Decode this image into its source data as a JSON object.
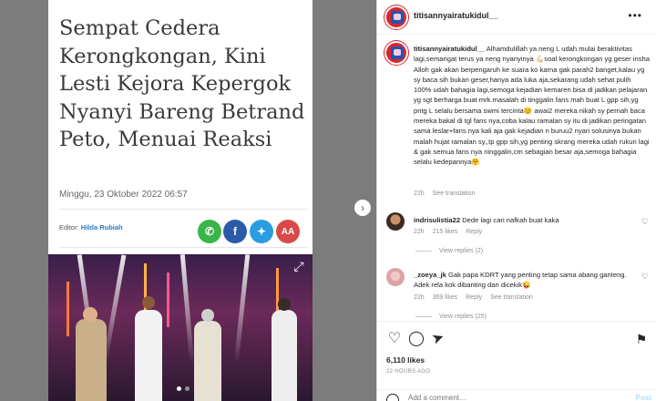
{
  "article": {
    "title": "Sempat Cedera Kerongkongan, Kini Lesti Kejora Kepergok Nyanyi Bareng Betrand Peto, Menuai Reaksi",
    "date": "Minggu, 23 Oktober 2022 06:57",
    "editor_label": "Editor:",
    "editor_name": "Hilda Rubiah",
    "share_aa": "AA"
  },
  "post": {
    "username": "titisannyairatukidul__",
    "more": "•••",
    "caption_user": "titisannyairatukidul__",
    "caption_text": "Alhamdulillah ya neng L udah mulai beraktivitas lagi,semangat terus ya neng nyanyinya 💪🏻soal kerongkongan yg geser insha Alloh gak akan berpengaruh ke suara ko karna gak parah2 banget,kalau yg sy baca sih bukan geser,hanya ada luka aja,sekarang udah sehat pulih 100% udah bahagia lagi,semoga kejadian kemaren bisa di jadikan pelajaran yg sgt berharga buat mrk.masalah di tinggalin fans mah buat L gpp sih,yg pntg L selalu bersama swmi tercinta😊 awai2 mereka nikah sy pernah baca mereka bakal di tgl fans nya,coba kalau ramalan sy itu di jadikan peringatan sama leslar+fans nya kali aja gak kejadian n buruu2 nyari solusinya bukan malah hujat ramalan sy,,tp gpp sih,yg penting skrang mereka udah rukun lagi & gak semua fans nya ninggalin,cm sebagian besar aja,semoga bahagia selalu kedepannya🤗",
    "caption_time": "22h",
    "see_translation": "See translation",
    "likes": "6,110 likes",
    "posted_ago": "22 HOURS AGO",
    "add_comment_placeholder": "Add a comment…",
    "post_label": "Post"
  },
  "comments": [
    {
      "user": "indrisulistia22",
      "text": "Dede lagi cari nafkah buat kaka",
      "time": "22h",
      "likes": "215 likes",
      "reply": "Reply",
      "view_replies": "View replies (2)"
    },
    {
      "user": "_zoeya_jk",
      "text": "Gak papa KDRT yang penting tetap sama abang ganteng. Adek rela kok dibanting dan dicekik😜",
      "time": "22h",
      "likes": "369 likes",
      "reply": "Reply",
      "see_translation": "See translation",
      "view_replies": "View replies (25)"
    }
  ],
  "colors": {
    "instagram_text": "#262626",
    "muted": "#8e8e8e",
    "link_blue": "#0095f6"
  }
}
